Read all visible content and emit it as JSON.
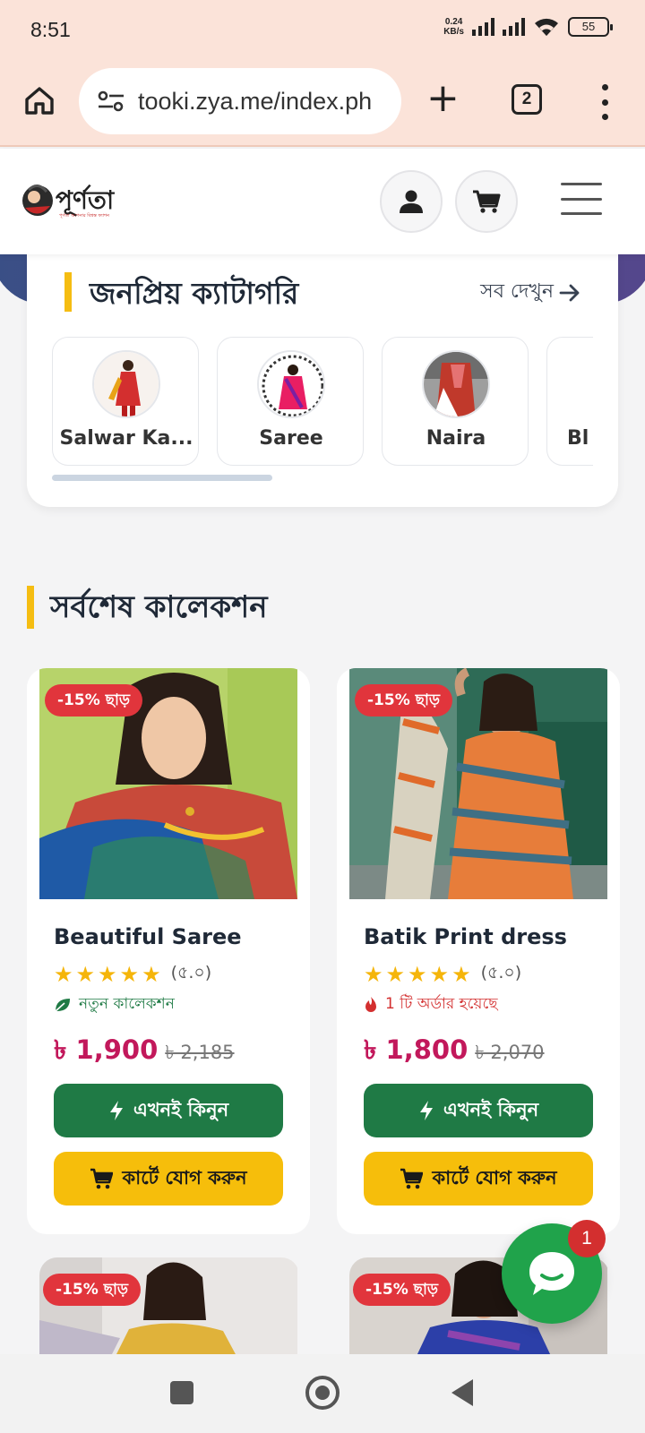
{
  "status_bar": {
    "time": "8:51",
    "net_speed_value": "0.24",
    "net_speed_unit": "KB/s",
    "battery": "55"
  },
  "browser": {
    "url": "tooki.zya.me/index.ph",
    "tab_count": "2"
  },
  "site": {
    "logo_text": "পূর্ণতা",
    "logo_tagline": "পূর্ণতা আপনার বিশ্বস্ত ফ্যাশন"
  },
  "categories": {
    "title": "জনপ্রিয় ক্যাটাগরি",
    "see_all": "সব দেখুন",
    "items": [
      {
        "label": "Salwar Ka..."
      },
      {
        "label": "Saree"
      },
      {
        "label": "Naira"
      },
      {
        "label": "Bl"
      }
    ]
  },
  "latest": {
    "title": "সর্বশেষ কালেকশন",
    "products": [
      {
        "badge": "-15% ছাড়",
        "name": "Beautiful Saree",
        "rating": "(৫.০)",
        "tag": "নতুন কালেকশন",
        "tag_color": "#1f7a45",
        "tag_icon": "leaf-icon",
        "price": "৳ 1,900",
        "old_price": "৳ 2,185",
        "buy_label": "এখনই কিনুন",
        "cart_label": "কার্টে যোগ করুন"
      },
      {
        "badge": "-15% ছাড়",
        "name": "Batik Print dress",
        "rating": "(৫.০)",
        "tag": "1 টি অর্ডার হয়েছে",
        "tag_color": "#d32f2f",
        "tag_icon": "fire-icon",
        "price": "৳ 1,800",
        "old_price": "৳ 2,070",
        "buy_label": "এখনই কিনুন",
        "cart_label": "কার্টে যোগ করুন"
      },
      {
        "badge": "-15% ছাড়"
      },
      {
        "badge": "-15% ছাড়"
      }
    ]
  },
  "chat": {
    "unread": "1"
  },
  "colors": {
    "accent_green": "#1f7a45",
    "accent_yellow": "#f6be0b",
    "price_pink": "#c2185b",
    "badge_red": "#e1353c"
  }
}
